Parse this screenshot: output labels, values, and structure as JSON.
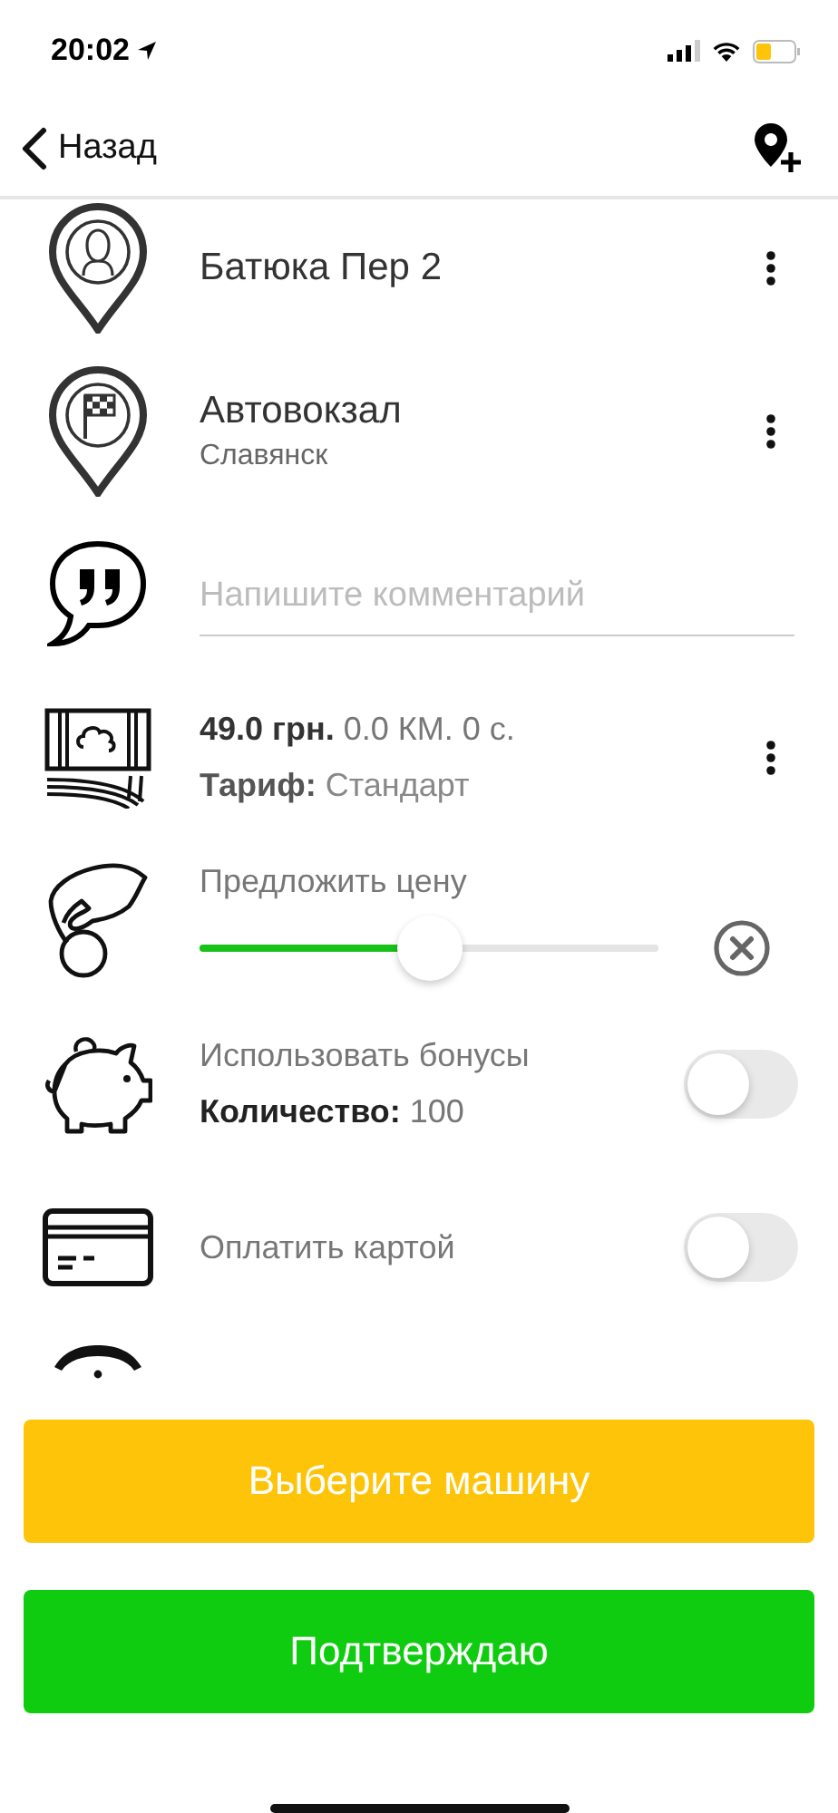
{
  "status_bar": {
    "time": "20:02"
  },
  "nav": {
    "back": "Назад"
  },
  "route": [
    {
      "kind": "start",
      "title": "Батюка Пер 2"
    },
    {
      "kind": "finish",
      "title": "Автовокзал",
      "subtitle": "Славянск"
    }
  ],
  "comment": {
    "placeholder": "Напишите комментарий"
  },
  "fare": {
    "summary": "**49.0 грн.** 0.0 КМ. 0 с.",
    "tariff": "**Тариф:** Стандарт"
  },
  "offer": {
    "label": "Предложить цену",
    "level": 0.5
  },
  "options": [
    {
      "kind": "bonus",
      "label": "Использовать бонусы",
      "detail": "**Количество:** 100",
      "on": false
    },
    {
      "kind": "card",
      "label": "Оплатить картой",
      "on": false
    }
  ],
  "buttons": [
    {
      "kind": "choose",
      "label": "Выберите машину"
    },
    {
      "kind": "confirm",
      "label": "Подтверждаю"
    }
  ]
}
